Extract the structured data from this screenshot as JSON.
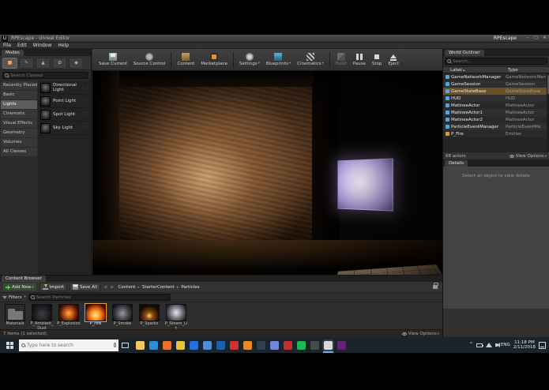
{
  "colors": {
    "accent_orange": "#f0a030",
    "outliner_selection": "#6b5226",
    "taskbar_bg": "#1b242b"
  },
  "titlebar": {
    "title": "RPEscape - Unreal Editor",
    "project": "RPEscape"
  },
  "menubar": {
    "items": [
      "File",
      "Edit",
      "Window",
      "Help"
    ]
  },
  "modes": {
    "tab": "Modes",
    "search_placeholder": "Search Classes",
    "categories": [
      {
        "label": "Recently Placed"
      },
      {
        "label": "Basic"
      },
      {
        "label": "Lights",
        "active": true
      },
      {
        "label": "Cinematic"
      },
      {
        "label": "Visual Effects"
      },
      {
        "label": "Geometry"
      },
      {
        "label": "Volumes"
      },
      {
        "label": "All Classes"
      }
    ],
    "items": [
      {
        "label": "Directional Light"
      },
      {
        "label": "Point Light"
      },
      {
        "label": "Spot Light"
      },
      {
        "label": "Sky Light"
      }
    ]
  },
  "toolbar": {
    "buttons": [
      {
        "label": "Save Current"
      },
      {
        "label": "Source Control"
      },
      {
        "label": "Content"
      },
      {
        "label": "Marketplace"
      },
      {
        "label": "Settings",
        "dropdown": true
      },
      {
        "label": "Blueprints",
        "dropdown": true
      },
      {
        "label": "Cinematics",
        "dropdown": true
      },
      {
        "label": "Build",
        "disabled": true
      },
      {
        "label": "Pause"
      },
      {
        "label": "Stop"
      },
      {
        "label": "Eject"
      }
    ]
  },
  "world_outliner": {
    "tab": "World Outliner",
    "search_placeholder": "Search...",
    "columns": {
      "label": "Label",
      "type": "Type"
    },
    "rows": [
      {
        "label": "GameNetworkManager",
        "type": "GameNetworkMan"
      },
      {
        "label": "GameSession",
        "type": "GameSession"
      },
      {
        "label": "GameStateBase",
        "type": "GameStateBase",
        "selected": true
      },
      {
        "label": "HUD",
        "type": "HUD"
      },
      {
        "label": "MatineeActor",
        "type": "MatineeActor"
      },
      {
        "label": "MatineeActor1",
        "type": "MatineeActor"
      },
      {
        "label": "MatineeActor2",
        "type": "MatineeActor"
      },
      {
        "label": "ParticleEventManager",
        "type": "ParticleEventMa"
      },
      {
        "label": "P_Fire",
        "type": "Emitter"
      }
    ],
    "footer": "68 actors",
    "view_options": "View Options"
  },
  "details": {
    "tab": "Details",
    "empty_message": "Select an object to view details"
  },
  "content_browser": {
    "tab": "Content Browser",
    "add_new": "Add New",
    "import": "Import",
    "save_all": "Save All",
    "breadcrumb": [
      "Content",
      "StarterContent",
      "Particles"
    ],
    "filters": "Filters",
    "search_placeholder": "Search Particles",
    "items": [
      {
        "name": "Materials",
        "kind": "folder"
      },
      {
        "name": "P_Ambient_Dust",
        "kind": "particle-dust"
      },
      {
        "name": "P_Explosion",
        "kind": "particle-explosion"
      },
      {
        "name": "P_Fire",
        "kind": "particle-fire",
        "selected": true
      },
      {
        "name": "P_Smoke",
        "kind": "particle-smoke"
      },
      {
        "name": "P_Sparks",
        "kind": "particle-sparks"
      },
      {
        "name": "P_Steam_Lit",
        "kind": "particle-steam"
      }
    ],
    "status": "7 items (1 selected)",
    "view_options": "View Options"
  },
  "taskbar": {
    "search_placeholder": "Type here to search",
    "apps": [
      {
        "name": "file-explorer",
        "color": "#f0c868"
      },
      {
        "name": "edge",
        "color": "#2a8fd8"
      },
      {
        "name": "firefox",
        "color": "#e8702a"
      },
      {
        "name": "chrome",
        "color": "#e8c23a"
      },
      {
        "name": "store",
        "color": "#2a6fd8"
      },
      {
        "name": "mail",
        "color": "#4a90d8"
      },
      {
        "name": "photos",
        "color": "#1f5fb0"
      },
      {
        "name": "youtube",
        "color": "#d03030"
      },
      {
        "name": "vlc",
        "color": "#e88a2a"
      },
      {
        "name": "steam",
        "color": "#31404f"
      },
      {
        "name": "discord",
        "color": "#7289da"
      },
      {
        "name": "adobe",
        "color": "#c03030"
      },
      {
        "name": "spotify",
        "color": "#1db954"
      },
      {
        "name": "epic-launcher",
        "color": "#4a4a4a"
      },
      {
        "name": "unreal-editor",
        "color": "#d8d8d8",
        "active": true
      },
      {
        "name": "visual-studio",
        "color": "#68217a"
      }
    ],
    "tray": {
      "lang": "ENG",
      "time": "11:18 PM",
      "date": "2/11/2018"
    }
  }
}
